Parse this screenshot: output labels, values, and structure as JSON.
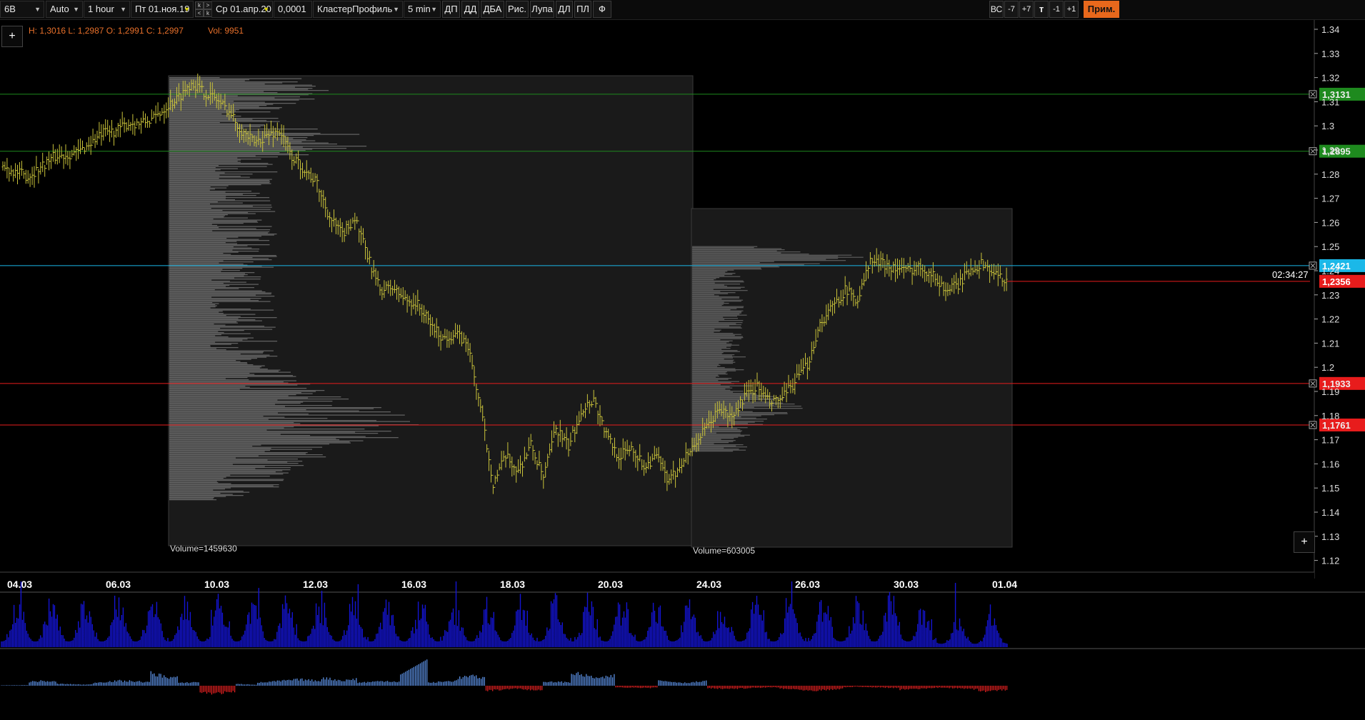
{
  "toolbar": {
    "instrument": "6В",
    "scale_mode": "Auto",
    "timeframe": "1 hour",
    "date_from": "Пт 01.ноя.19",
    "date_to": "Ср 01.апр.20",
    "step": "0,0001",
    "chart_type": "КластерПрофиль",
    "profile_tf": "5 min",
    "buttons": [
      "ДП",
      "ДД",
      "ДБА",
      "Рис.",
      "Лупа",
      "ДЛ",
      "ПЛ",
      "Ф"
    ],
    "right_buttons": [
      "ВС",
      "-7",
      "+7",
      "т",
      "-1",
      "+1"
    ],
    "prim_label": "Прим.",
    "nav": [
      "k",
      ">",
      "<",
      "k"
    ]
  },
  "ohlc": {
    "high": "H: 1,3016",
    "low": "L: 1,2987",
    "open": "O: 1,2991",
    "close": "C: 1,2997",
    "vol": "Vol: 9951"
  },
  "add_label": "+",
  "time_readout": "02:34:27",
  "colors": {
    "candle": "#c9c23a",
    "green_level": "#1e8a1e",
    "cyan_level": "#1bb8e8",
    "red_level": "#e81c1c",
    "volume_blue": "#1414d2",
    "delta_pos": "#5a8ee0",
    "delta_neg": "#e02020",
    "profile_gray": "#6e6e6e"
  },
  "chart_data": {
    "type": "line",
    "x_ticks": [
      "04.03",
      "06.03",
      "10.03",
      "12.03",
      "16.03",
      "18.03",
      "20.03",
      "24.03",
      "26.03",
      "30.03",
      "01.04"
    ],
    "y_ticks": [
      "1.34",
      "1.33",
      "1.32",
      "1.31",
      "1.3",
      "1.29",
      "1.28",
      "1.27",
      "1.26",
      "1.25",
      "1.24",
      "1.23",
      "1.22",
      "1.21",
      "1.2",
      "1.19",
      "1.18",
      "1.17",
      "1.16",
      "1.15",
      "1.14",
      "1.13",
      "1.12"
    ],
    "ylim": [
      1.118,
      1.344
    ],
    "series": [
      {
        "values": [
          1.283,
          1.281,
          1.279,
          1.283,
          1.287,
          1.288,
          1.289,
          1.293,
          1.297,
          1.298,
          1.301,
          1.301,
          1.303,
          1.308,
          1.312,
          1.318,
          1.314,
          1.311,
          1.306,
          1.298,
          1.293,
          1.296,
          1.298,
          1.287,
          1.282,
          1.276,
          1.262,
          1.255,
          1.262,
          1.246,
          1.232,
          1.233,
          1.228,
          1.226,
          1.218,
          1.212,
          1.214,
          1.209,
          1.183,
          1.152,
          1.163,
          1.157,
          1.168,
          1.154,
          1.175,
          1.167,
          1.182,
          1.187,
          1.172,
          1.163,
          1.167,
          1.159,
          1.163,
          1.152,
          1.161,
          1.168,
          1.175,
          1.183,
          1.179,
          1.188,
          1.192,
          1.185,
          1.187,
          1.194,
          1.201,
          1.218,
          1.225,
          1.232,
          1.228,
          1.244,
          1.243,
          1.241,
          1.24,
          1.242,
          1.238,
          1.232,
          1.234,
          1.241,
          1.243,
          1.238,
          1.236
        ]
      }
    ],
    "levels": [
      {
        "label": "1,3131",
        "value": 1.3131,
        "color": "green"
      },
      {
        "label": "1,2895",
        "value": 1.2895,
        "color": "green"
      },
      {
        "label": "1,2421",
        "value": 1.2421,
        "color": "cyan"
      },
      {
        "label": "1,2356",
        "value": 1.2356,
        "color": "red"
      },
      {
        "label": "1,1933",
        "value": 1.1933,
        "color": "red"
      },
      {
        "label": "1,1761",
        "value": 1.1761,
        "color": "red"
      }
    ],
    "profiles": [
      {
        "label": "Volume=1459630",
        "volume": 1459630,
        "price_range": [
          1.145,
          1.32
        ]
      },
      {
        "label": "Volume=603005",
        "volume": 603005,
        "price_range": [
          1.165,
          1.25
        ]
      }
    ],
    "volume_bars_count": 720,
    "delta_panel": true
  }
}
